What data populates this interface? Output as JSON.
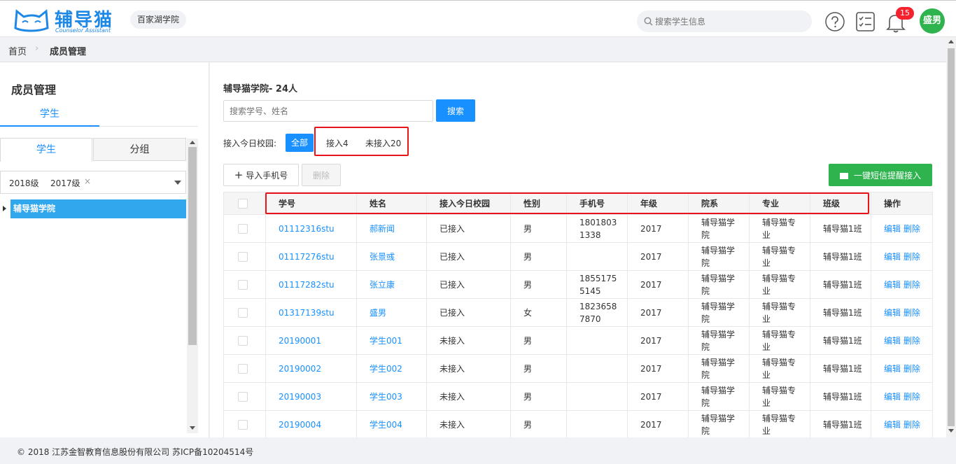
{
  "header": {
    "logo_title": "辅导猫",
    "logo_subtitle": "Counselor Assistant",
    "college_tag": "百家湖学院",
    "search_placeholder": "搜索学生信息",
    "notification_count": "15",
    "user_avatar": "盛男"
  },
  "breadcrumb": {
    "home": "首页",
    "current": "成员管理"
  },
  "sidebar": {
    "title": "成员管理",
    "top_tab": "学生",
    "seg_student": "学生",
    "seg_group": "分组",
    "grade_tags": [
      "2018级",
      "2017级"
    ],
    "grade_clear": "×",
    "tree_node": "辅导猫学院"
  },
  "main": {
    "title": "辅导猫学院- 24人",
    "search_placeholder": "搜索学号、姓名",
    "search_button": "搜索",
    "filter_label": "接入今日校园:",
    "filter_all": "全部",
    "filter_joined": "接入4",
    "filter_not_joined": "未接入20",
    "import_button": "导入手机号",
    "import_plus": "+",
    "delete_button": "删除",
    "sms_button": "一键短信提醒接入"
  },
  "table": {
    "columns": [
      "学号",
      "姓名",
      "接入今日校园",
      "性别",
      "手机号",
      "年级",
      "院系",
      "专业",
      "班级",
      "操作"
    ],
    "rows": [
      {
        "id": "01112316stu",
        "name": "郝新闻",
        "status": "已接入",
        "gender": "男",
        "phone": "18018031338",
        "grade": "2017",
        "dept": "辅导猫学院",
        "major": "辅导猫专业",
        "class": "辅导猫1班",
        "ops": "编辑 删除"
      },
      {
        "id": "01117276stu",
        "name": "张景彧",
        "status": "已接入",
        "gender": "男",
        "phone": "",
        "grade": "2017",
        "dept": "辅导猫学院",
        "major": "辅导猫专业",
        "class": "辅导猫1班",
        "ops": "编辑 删除"
      },
      {
        "id": "01117282stu",
        "name": "张立康",
        "status": "已接入",
        "gender": "男",
        "phone": "18551755145",
        "grade": "2017",
        "dept": "辅导猫学院",
        "major": "辅导猫专业",
        "class": "辅导猫1班",
        "ops": "编辑 删除"
      },
      {
        "id": "01317139stu",
        "name": "盛男",
        "status": "已接入",
        "gender": "女",
        "phone": "18236587870",
        "grade": "2017",
        "dept": "辅导猫学院",
        "major": "辅导猫专业",
        "class": "辅导猫1班",
        "ops": "编辑 删除"
      },
      {
        "id": "20190001",
        "name": "学生001",
        "status": "未接入",
        "gender": "男",
        "phone": "",
        "grade": "2017",
        "dept": "辅导猫学院",
        "major": "辅导猫专业",
        "class": "辅导猫1班",
        "ops": "编辑 删除"
      },
      {
        "id": "20190002",
        "name": "学生002",
        "status": "未接入",
        "gender": "男",
        "phone": "",
        "grade": "2017",
        "dept": "辅导猫学院",
        "major": "辅导猫专业",
        "class": "辅导猫1班",
        "ops": "编辑 删除"
      },
      {
        "id": "20190003",
        "name": "学生003",
        "status": "未接入",
        "gender": "男",
        "phone": "",
        "grade": "2017",
        "dept": "辅导猫学院",
        "major": "辅导猫专业",
        "class": "辅导猫1班",
        "ops": "编辑 删除"
      },
      {
        "id": "20190004",
        "name": "学生004",
        "status": "未接入",
        "gender": "男",
        "phone": "",
        "grade": "2017",
        "dept": "辅导猫学院",
        "major": "辅导猫专业",
        "class": "辅导猫1班",
        "ops": "编辑 删除"
      }
    ]
  },
  "footer": {
    "copyright": "© 2018 江苏金智教育信息股份有限公司 苏ICP备10204514号"
  },
  "colors": {
    "brand_blue": "#1890ff",
    "success_green": "#2eb34e",
    "highlight_red": "#e8141a",
    "tree_selected": "#31a7ee"
  }
}
